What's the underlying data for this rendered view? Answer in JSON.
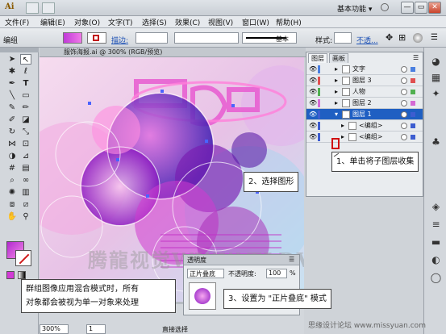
{
  "app": {
    "logo": "Ai",
    "workspace": "基本功能 ▾"
  },
  "window_buttons": {
    "minimize": "—",
    "restore": "▭",
    "close": "✕"
  },
  "menu": [
    "文件(F)",
    "编辑(E)",
    "对象(O)",
    "文字(T)",
    "选择(S)",
    "效果(C)",
    "视图(V)",
    "窗口(W)",
    "帮助(H)"
  ],
  "controlbar": {
    "selection": "编组",
    "stroke_label": "描边:",
    "stroke_style": "基本",
    "style_label": "样式:",
    "opacity": "不透..."
  },
  "document": {
    "tab": "服饰海报.ai @ 300% (RGB/预览)",
    "watermark": "腾龍视觉WWW.TLDVI.NET"
  },
  "statusbar": {
    "zoom": "300%",
    "page": "1",
    "mode": "直接选择"
  },
  "layers": {
    "tabs": [
      "图层",
      "画板"
    ],
    "rows": [
      {
        "name": "文字",
        "color": "#4a7fe0",
        "indent": 0,
        "selected": false
      },
      {
        "name": "图层 3",
        "color": "#e05050",
        "indent": 0,
        "selected": false
      },
      {
        "name": "人物",
        "color": "#50b050",
        "indent": 0,
        "selected": false
      },
      {
        "name": "图层 2",
        "color": "#d46ad4",
        "indent": 0,
        "selected": false
      },
      {
        "name": "图层 1",
        "color": "#3d5dd0",
        "indent": 0,
        "selected": true
      },
      {
        "name": "<编组>",
        "color": "#3d5dd0",
        "indent": 1,
        "selected": false
      },
      {
        "name": "<编组>",
        "color": "#3d5dd0",
        "indent": 1,
        "selected": false
      }
    ],
    "accent": "#1f5fc2"
  },
  "transparency": {
    "title": "透明度",
    "blend_mode": "正片叠底",
    "opacity_label": "不透明度:",
    "opacity_value": "100",
    "percent": "%"
  },
  "callouts": {
    "collapse_sublayers": "1、单击将子图层收集",
    "select_shape": "2、选择图形",
    "set_multiply": "3、设置为 \"正片叠底\" 模式",
    "group_note_line1": "群组图像应用混合模式时，所有",
    "group_note_line2": "对象都会被视为单一对象来处理"
  },
  "credit": "思缘设计论坛 www.missyuan.com"
}
